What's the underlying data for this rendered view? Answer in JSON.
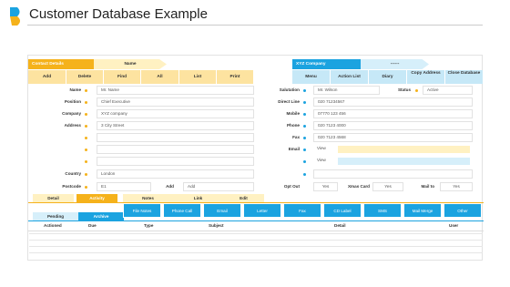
{
  "page": {
    "title": "Customer Database Example"
  },
  "header_left": {
    "section": "Contact Details",
    "name_tab": "Name"
  },
  "header_right": {
    "company": "XYZ Company",
    "dash": "------"
  },
  "toolbar_left": [
    "Add",
    "Delete",
    "Find",
    "All",
    "List",
    "Print"
  ],
  "toolbar_right": [
    "Menu",
    "Action List",
    "Diary",
    "Copy Address",
    "Close Database"
  ],
  "form_left": {
    "name_label": "Name",
    "name_value": "Mr. Name",
    "position_label": "Position",
    "position_value": "Chief Executive",
    "company_label": "Company",
    "company_value": "XYZ company",
    "address_label": "Address",
    "address_value": "3 City Street",
    "country_label": "Country",
    "country_value": "London",
    "postcode_label": "Postcode",
    "postcode_value": "E1",
    "add_label": "Add",
    "add_value": "Add"
  },
  "form_right": {
    "salutation_label": "Salutation",
    "salutation_value": "Mr. Wilson",
    "status_label": "Status",
    "status_value": "Active",
    "direct_label": "Direct Line",
    "direct_value": "020 71234567",
    "mobile_label": "Mobile",
    "mobile_value": "07770 123 456",
    "phone_label": "Phone",
    "phone_value": "020 7123 4000",
    "fax_label": "Fax",
    "fax_value": "020 7123 4568",
    "email_label": "Email",
    "email_view1": "View",
    "email_view2": "View",
    "optout_label": "Opt Out",
    "optout_value": "Yes",
    "xmas_label": "Xmas Card",
    "xmas_value": "Yes",
    "mail_label": "Mail to",
    "mail_value": "Yes"
  },
  "detail_tabs": [
    "Detail",
    "Activity",
    "Notes",
    "Link",
    "Edit"
  ],
  "status_tabs": [
    "Pending",
    "Archive"
  ],
  "action_buttons": [
    "File Notes",
    "Phone Call",
    "Email",
    "Letter",
    "Fax",
    "CD Label",
    "SMS",
    "Mail Merge",
    "Other"
  ],
  "table_headers": [
    "Actioned",
    "Due",
    "Type",
    "Subject",
    "Detail",
    "User"
  ],
  "colors": {
    "accent_orange": "#f5b21b",
    "accent_blue": "#1ba3e0",
    "light_yellow": "#fff1c2",
    "light_blue": "#d6effa"
  }
}
